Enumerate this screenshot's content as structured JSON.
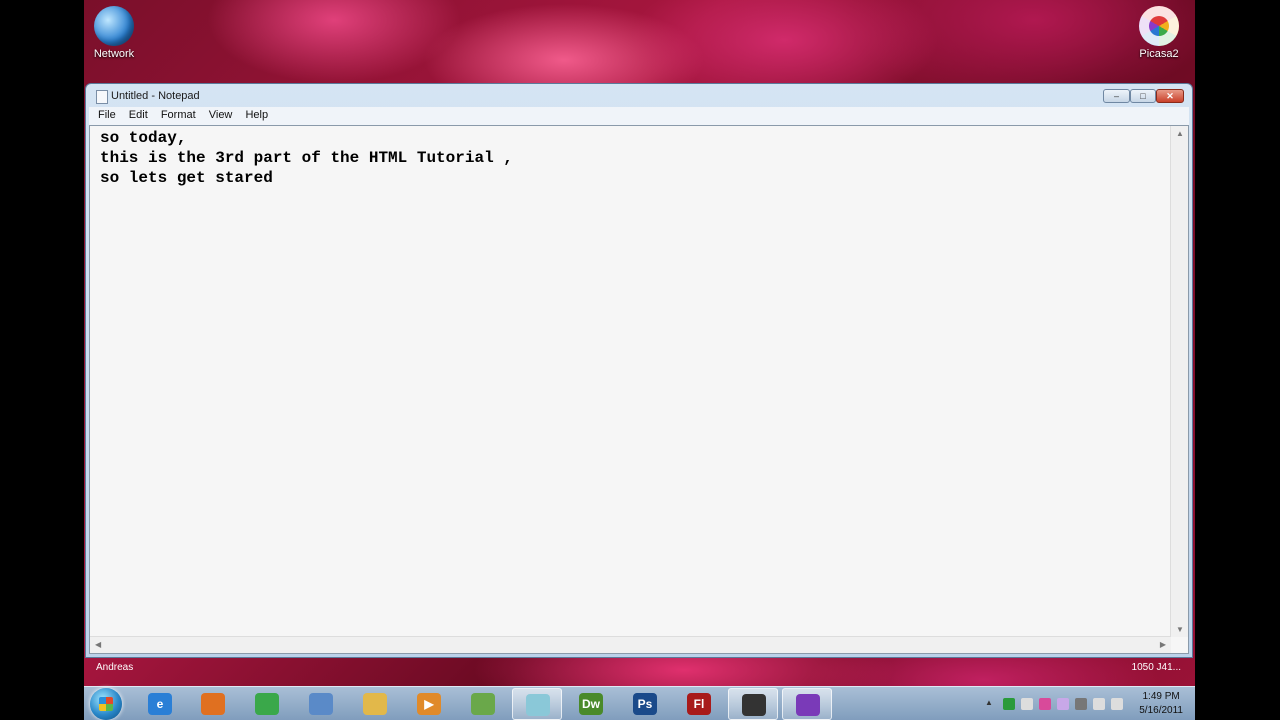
{
  "desktop": {
    "icons": [
      {
        "label": "Network",
        "icon": "network-icon"
      },
      {
        "label": "Picasa2",
        "icon": "picasa-icon"
      }
    ]
  },
  "window": {
    "title": "Untitled - Notepad",
    "menu": [
      "File",
      "Edit",
      "Format",
      "View",
      "Help"
    ],
    "content": "so today,\nthis is the 3rd part of the HTML Tutorial ,\nso lets get stared",
    "controls": {
      "minimize": "–",
      "maximize": "□",
      "close": "✕"
    }
  },
  "info_strip": {
    "user": "Andreas",
    "resolution": "1050 J41..."
  },
  "taskbar": {
    "apps": [
      {
        "name": "internet-explorer",
        "glyph": "e",
        "color": "#2a7fd6"
      },
      {
        "name": "firefox",
        "glyph": "",
        "color": "#e07020"
      },
      {
        "name": "chrome",
        "glyph": "",
        "color": "#3aa84a"
      },
      {
        "name": "safari",
        "glyph": "",
        "color": "#5a8ac8"
      },
      {
        "name": "file-explorer",
        "glyph": "",
        "color": "#e2b84a"
      },
      {
        "name": "media-player",
        "glyph": "▶",
        "color": "#e08a2a"
      },
      {
        "name": "notepad-plus",
        "glyph": "",
        "color": "#6aa84a"
      },
      {
        "name": "notepad",
        "glyph": "",
        "color": "#8ac8d8"
      },
      {
        "name": "dreamweaver",
        "glyph": "Dw",
        "color": "#4a8a2a"
      },
      {
        "name": "photoshop",
        "glyph": "Ps",
        "color": "#1a4a8a"
      },
      {
        "name": "flash",
        "glyph": "Fl",
        "color": "#a81a1a"
      },
      {
        "name": "hypercam",
        "glyph": "",
        "color": "#333333"
      },
      {
        "name": "bittorrent",
        "glyph": "",
        "color": "#7a3ab8"
      }
    ],
    "clock": {
      "time": "1:49 PM",
      "date": "5/16/2011"
    }
  }
}
